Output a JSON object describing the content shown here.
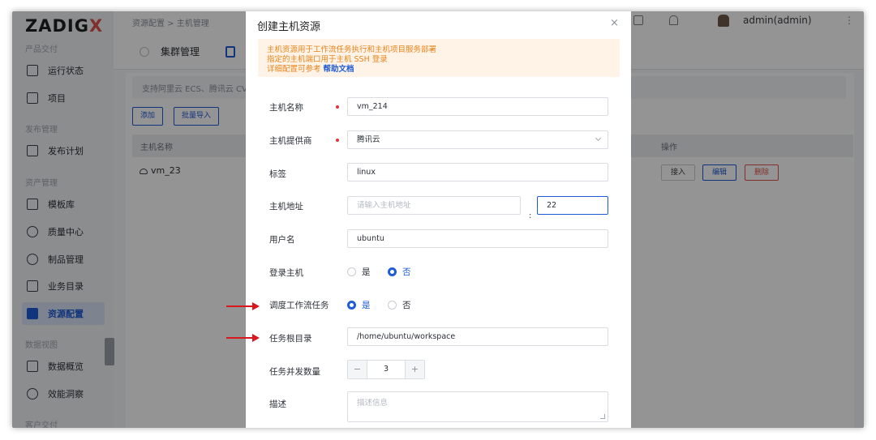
{
  "app": {
    "logo_main": "ZADIG",
    "logo_x": "X"
  },
  "sidebar": {
    "sections": [
      "产品交付",
      "发布管理",
      "资产管理",
      "数据视图",
      "客户交付"
    ],
    "items": [
      {
        "label": "运行状态",
        "icon": "monitor-icon"
      },
      {
        "label": "项目",
        "icon": "project-icon"
      },
      {
        "label": "发布计划",
        "icon": "release-plan-icon"
      },
      {
        "label": "模板库",
        "icon": "template-icon"
      },
      {
        "label": "质量中心",
        "icon": "quality-icon"
      },
      {
        "label": "制品管理",
        "icon": "artifact-icon"
      },
      {
        "label": "业务目录",
        "icon": "catalog-icon"
      },
      {
        "label": "资源配置",
        "icon": "resource-icon",
        "active": true
      },
      {
        "label": "数据概览",
        "icon": "dashboard-icon"
      },
      {
        "label": "效能洞察",
        "icon": "insight-icon"
      }
    ]
  },
  "header": {
    "breadcrumb": "资源配置  >  主机管理",
    "user": "admin(admin)",
    "more": "⋮"
  },
  "page": {
    "tab_cluster": "集群管理",
    "tip": "支持阿里云 ECS、腾讯云 CV",
    "add_button": "添加",
    "import_button": "批量导入",
    "col_name": "主机名称",
    "col_op": "操作",
    "rows": [
      {
        "name": "vm_23",
        "access": "接入",
        "edit": "编辑",
        "delete": "删除"
      }
    ]
  },
  "modal": {
    "title": "创建主机资源",
    "close": "×",
    "notice_line1": "主机资源用于工作流任务执行和主机项目服务部署",
    "notice_line2": "指定的主机端口用于主机 SSH 登录",
    "notice_line3_prefix": "详细配置可参考",
    "notice_link": "帮助文档",
    "fields": {
      "name_label": "主机名称",
      "name_value": "vm_214",
      "provider_label": "主机提供商",
      "provider_value": "腾讯云",
      "tag_label": "标签",
      "tag_value": "linux",
      "address_label": "主机地址",
      "address_placeholder": "请输入主机地址",
      "colon": ":",
      "port_value": "22",
      "username_label": "用户名",
      "username_value": "ubuntu",
      "login_label": "登录主机",
      "login_yes": "是",
      "login_no": "否",
      "login_selected": "否",
      "schedule_label": "调度工作流任务",
      "schedule_yes": "是",
      "schedule_no": "否",
      "schedule_selected": "是",
      "workdir_label": "任务根目录",
      "workdir_value": "/home/ubuntu/workspace",
      "concurrency_label": "任务并发数量",
      "concurrency_value": "3",
      "minus": "−",
      "plus": "+",
      "desc_label": "描述",
      "desc_placeholder": "描述信息"
    }
  }
}
